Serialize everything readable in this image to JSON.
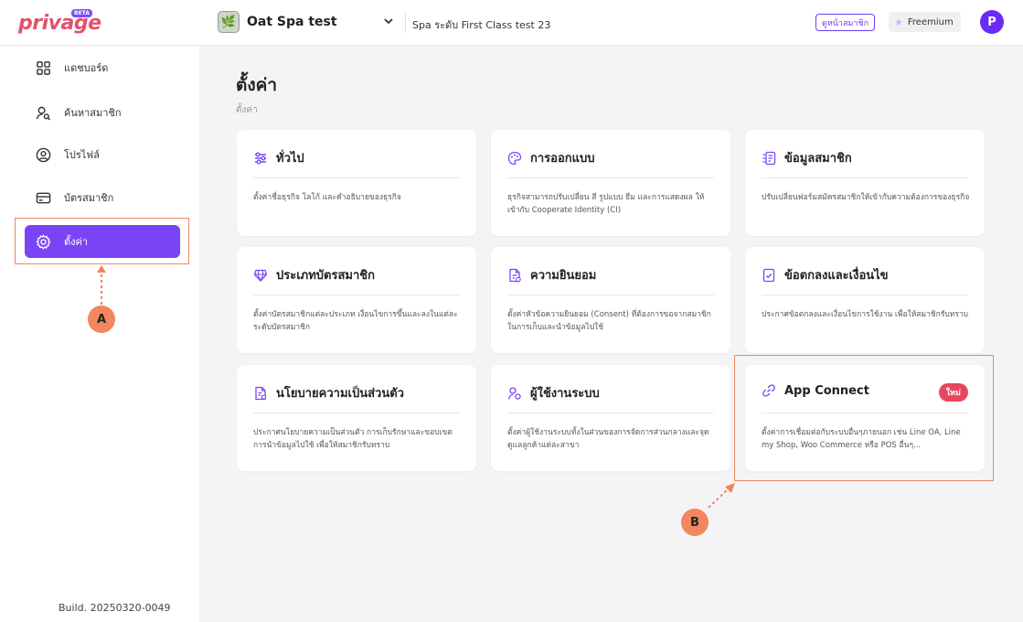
{
  "header": {
    "logo_text": "privage",
    "logo_badge": "BETA",
    "shop_name": "Oat Spa test",
    "branch_name": "Spa ระดับ First Class test 23",
    "member_page_label": "ดูหน้าสมาชิก",
    "plan_label": "Freemium",
    "user_initial": "P"
  },
  "sidebar": {
    "items": [
      {
        "label": "แดชบอร์ด",
        "icon": "dashboard-icon",
        "active": false
      },
      {
        "label": "ค้นหาสมาชิก",
        "icon": "search-member-icon",
        "active": false
      },
      {
        "label": "โปรไฟล์",
        "icon": "profile-icon",
        "active": false
      },
      {
        "label": "บัตรสมาชิก",
        "icon": "card-icon",
        "active": false
      },
      {
        "label": "ตั้งค่า",
        "icon": "gear-icon",
        "active": true
      }
    ],
    "build": "Build. 20250320-0049"
  },
  "main": {
    "title": "ตั้งค่า",
    "breadcrumb": "ตั้งค่า",
    "cards": [
      {
        "title": "ทั่วไป",
        "icon": "sliders-icon",
        "desc": "ตั้งค่าชื่อธุรกิจ โลโก้ และคำอธิบายของธุรกิจ"
      },
      {
        "title": "การออกแบบ",
        "icon": "palette-icon",
        "desc": "ธุรกิจสามารถปรับเปลี่ยน สี รูปแบบ ธีม และการแสดงผล ให้เข้ากับ Cooperate Identity (CI)"
      },
      {
        "title": "ข้อมูลสมาชิก",
        "icon": "member-form-icon",
        "desc": "ปรับเปลี่ยนฟอร์มสมัครสมาชิกให้เข้ากับความต้องการของธุรกิจ"
      },
      {
        "title": "ประเภทบัตรสมาชิก",
        "icon": "diamond-icon",
        "desc": "ตั้งค่าบัตรสมาชิกแต่ละประเภท เงื่อนไขการขึ้นและลงในแต่ละระดับบัตรสมาชิก"
      },
      {
        "title": "ความยินยอม",
        "icon": "consent-doc-icon",
        "desc": "ตั้งค่าหัวข้อความยินยอม (Consent) ที่ต้องการขอจากสมาชิก ในการเก็บและนำข้อมูลไปใช้"
      },
      {
        "title": "ข้อตกลงและเงื่อนไข",
        "icon": "terms-doc-icon",
        "desc": "ประกาศข้อตกลงและเงื่อนไขการใช้งาน เพื่อให้สมาชิกรับทราบ"
      },
      {
        "title": "นโยบายความเป็นส่วนตัว",
        "icon": "privacy-doc-icon",
        "desc": "ประกาศนโยบายความเป็นส่วนตัว การเก็บรักษาและขอบเขตการนำข้อมูลไปใช้ เพื่อให้สมาชิกรับทราบ"
      },
      {
        "title": "ผู้ใช้งานระบบ",
        "icon": "users-icon",
        "desc": "ตั้งค่าผู้ใช้งานระบบทั้งในส่วนของการจัดการส่วนกลางและจุดดูแลลูกค้าแต่ละสาขา"
      },
      {
        "title": "App Connect",
        "icon": "link-icon",
        "desc": "ตั้งค่าการเชื่อมต่อกับระบบอื่นๆภายนอก เช่น Line OA, Line my Shop, Woo Commerce หรือ POS อื่นๆ...",
        "badge": "ใหม่"
      }
    ]
  },
  "annotations": {
    "a": "A",
    "b": "B"
  },
  "colors": {
    "accent": "#7a44f6",
    "annotation": "#f0855f",
    "new_badge": "#e8465e"
  }
}
